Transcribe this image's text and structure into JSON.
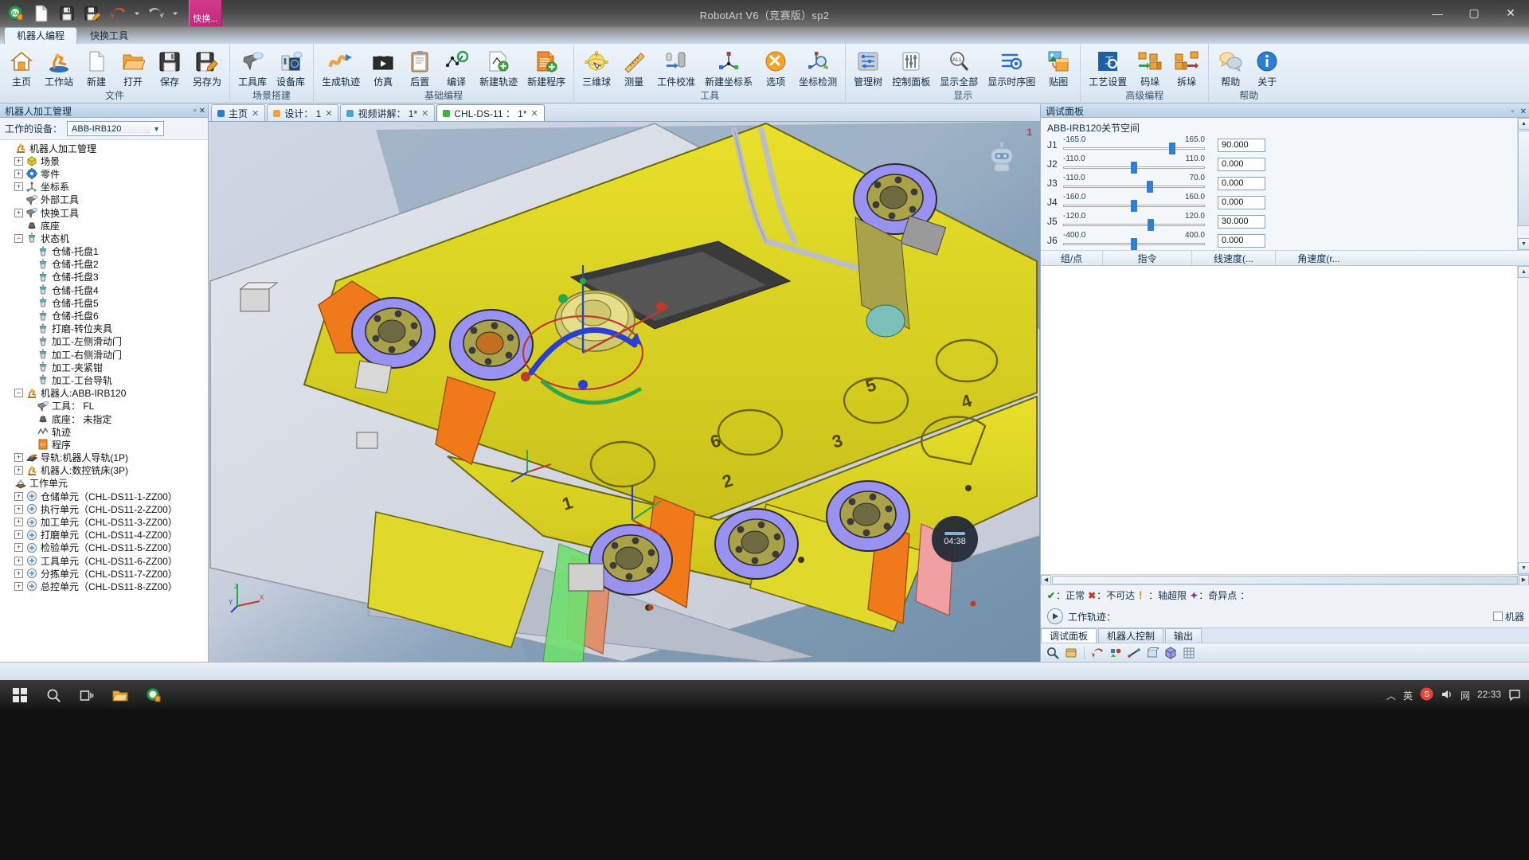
{
  "window": {
    "title": "RobotArt V6（竞赛版）sp2",
    "minimize": "—",
    "maximize": "▢",
    "close": "✕"
  },
  "quick_access": {
    "items": [
      {
        "name": "app-logo-icon",
        "label": "RobotArt"
      },
      {
        "name": "new-file-icon",
        "label": "新建"
      },
      {
        "name": "save-icon",
        "label": "保存"
      },
      {
        "name": "save-as-icon",
        "label": "另存为"
      },
      {
        "name": "undo-icon",
        "label": "撤销"
      },
      {
        "name": "redo-icon",
        "label": "重做"
      }
    ],
    "pinned_tab": "快换..."
  },
  "ribbon": {
    "tabs": [
      {
        "label": "机器人编程",
        "active": true
      },
      {
        "label": "快换工具",
        "active": false
      }
    ],
    "groups": [
      {
        "title": "文件",
        "items": [
          {
            "label": "主页",
            "icon": "home-icon"
          },
          {
            "label": "工作站",
            "icon": "workstation-icon"
          },
          {
            "label": "新建",
            "icon": "new-document-icon"
          },
          {
            "label": "打开",
            "icon": "open-folder-icon"
          },
          {
            "label": "保存",
            "icon": "floppy-save-icon"
          },
          {
            "label": "另存为",
            "icon": "floppy-save-as-icon"
          }
        ]
      },
      {
        "title": "场景搭建",
        "items": [
          {
            "label": "工具库",
            "icon": "tool-library-icon"
          },
          {
            "label": "设备库",
            "icon": "device-library-icon"
          }
        ]
      },
      {
        "title": "基础编程",
        "items": [
          {
            "label": "生成轨迹",
            "icon": "generate-path-icon"
          },
          {
            "label": "仿真",
            "icon": "simulation-icon"
          },
          {
            "label": "后置",
            "icon": "postprocess-icon"
          },
          {
            "label": "编译",
            "icon": "compile-icon"
          },
          {
            "label": "新建轨迹",
            "icon": "new-path-icon"
          },
          {
            "label": "新建程序",
            "icon": "new-program-icon"
          }
        ]
      },
      {
        "title": "工具",
        "items": [
          {
            "label": "三维球",
            "icon": "triball-icon"
          },
          {
            "label": "测量",
            "icon": "measure-icon"
          },
          {
            "label": "工件校准",
            "icon": "workpiece-calibration-icon"
          },
          {
            "label": "新建坐标系",
            "icon": "new-coordinate-system-icon"
          },
          {
            "label": "选项",
            "icon": "options-icon"
          },
          {
            "label": "坐标检测",
            "icon": "coordinate-detect-icon"
          }
        ]
      },
      {
        "title": "显示",
        "items": [
          {
            "label": "管理树",
            "icon": "manage-tree-icon"
          },
          {
            "label": "控制面板",
            "icon": "control-panel-icon"
          },
          {
            "label": "显示全部",
            "icon": "show-all-icon"
          },
          {
            "label": "显示时序图",
            "icon": "show-timeline-icon"
          },
          {
            "label": "贴图",
            "icon": "texture-icon"
          }
        ]
      },
      {
        "title": "高级编程",
        "items": [
          {
            "label": "工艺设置",
            "icon": "process-settings-icon"
          },
          {
            "label": "码垛",
            "icon": "palletize-icon"
          },
          {
            "label": "拆垛",
            "icon": "depalletize-icon"
          }
        ]
      },
      {
        "title": "帮助",
        "items": [
          {
            "label": "帮助",
            "icon": "help-icon"
          },
          {
            "label": "关于",
            "icon": "about-icon"
          }
        ]
      }
    ]
  },
  "document_tabs": [
    {
      "label": "主页",
      "active": false,
      "closable": true
    },
    {
      "label": "设计： 1",
      "active": false,
      "closable": true
    },
    {
      "label": "视频讲解： 1*",
      "active": false,
      "closable": true
    },
    {
      "label": "CHL-DS-11 ： 1*",
      "active": true,
      "closable": true
    }
  ],
  "left_panel": {
    "title": "机器人加工管理",
    "device_label": "工作的设备：",
    "device_value": "ABB-IRB120",
    "tree": [
      {
        "label": "机器人加工管理",
        "indent": 0,
        "toggle": "none",
        "icon": "robot-icon"
      },
      {
        "label": "场景",
        "indent": 1,
        "toggle": "plus",
        "icon": "scene-icon"
      },
      {
        "label": "零件",
        "indent": 1,
        "toggle": "plus",
        "icon": "part-icon"
      },
      {
        "label": "坐标系",
        "indent": 1,
        "toggle": "plus",
        "icon": "coordinate-icon"
      },
      {
        "label": "外部工具",
        "indent": 1,
        "toggle": "none",
        "icon": "tool-icon"
      },
      {
        "label": "快换工具",
        "indent": 1,
        "toggle": "plus",
        "icon": "tool-icon"
      },
      {
        "label": "底座",
        "indent": 1,
        "toggle": "none",
        "icon": "base-icon"
      },
      {
        "label": "状态机",
        "indent": 1,
        "toggle": "minus",
        "icon": "statemachine-icon"
      },
      {
        "label": "仓储-托盘1",
        "indent": 2,
        "toggle": "none",
        "icon": "statemachine-icon"
      },
      {
        "label": "仓储-托盘2",
        "indent": 2,
        "toggle": "none",
        "icon": "statemachine-icon"
      },
      {
        "label": "仓储-托盘3",
        "indent": 2,
        "toggle": "none",
        "icon": "statemachine-icon"
      },
      {
        "label": "仓储-托盘4",
        "indent": 2,
        "toggle": "none",
        "icon": "statemachine-icon"
      },
      {
        "label": "仓储-托盘5",
        "indent": 2,
        "toggle": "none",
        "icon": "statemachine-icon"
      },
      {
        "label": "仓储-托盘6",
        "indent": 2,
        "toggle": "none",
        "icon": "statemachine-icon"
      },
      {
        "label": "打磨-转位夹具",
        "indent": 2,
        "toggle": "none",
        "icon": "statemachine-icon"
      },
      {
        "label": "加工-左侧滑动门",
        "indent": 2,
        "toggle": "none",
        "icon": "statemachine-icon"
      },
      {
        "label": "加工-右侧滑动门",
        "indent": 2,
        "toggle": "none",
        "icon": "statemachine-icon"
      },
      {
        "label": "加工-夹紧钳",
        "indent": 2,
        "toggle": "none",
        "icon": "statemachine-icon"
      },
      {
        "label": "加工-工台导轨",
        "indent": 2,
        "toggle": "none",
        "icon": "statemachine-icon"
      },
      {
        "label": "机器人:ABB-IRB120",
        "indent": 1,
        "toggle": "minus",
        "icon": "robot-icon"
      },
      {
        "label": "工具： FL",
        "indent": 2,
        "toggle": "none",
        "icon": "tool-icon"
      },
      {
        "label": "底座： 未指定",
        "indent": 2,
        "toggle": "none",
        "icon": "base-icon"
      },
      {
        "label": "轨迹",
        "indent": 2,
        "toggle": "none",
        "icon": "path-icon"
      },
      {
        "label": "程序",
        "indent": 2,
        "toggle": "none",
        "icon": "program-icon"
      },
      {
        "label": "导轨:机器人导轨(1P)",
        "indent": 1,
        "toggle": "plus",
        "icon": "rail-icon"
      },
      {
        "label": "机器人:数控铣床(3P)",
        "indent": 1,
        "toggle": "plus",
        "icon": "robot-icon"
      },
      {
        "label": "工作单元",
        "indent": 0,
        "toggle": "none",
        "icon": "workcell-icon"
      },
      {
        "label": "仓储单元（CHL-DS11-1-ZZ00）",
        "indent": 1,
        "toggle": "plus",
        "icon": "unit-icon"
      },
      {
        "label": "执行单元（CHL-DS11-2-ZZ00）",
        "indent": 1,
        "toggle": "plus",
        "icon": "unit-icon"
      },
      {
        "label": "加工单元（CHL-DS11-3-ZZ00）",
        "indent": 1,
        "toggle": "plus",
        "icon": "unit-icon"
      },
      {
        "label": "打磨单元（CHL-DS11-4-ZZ00）",
        "indent": 1,
        "toggle": "plus",
        "icon": "unit-icon"
      },
      {
        "label": "检验单元（CHL-DS11-5-ZZ00）",
        "indent": 1,
        "toggle": "plus",
        "icon": "unit-icon"
      },
      {
        "label": "工具单元（CHL-DS11-6-ZZ00）",
        "indent": 1,
        "toggle": "plus",
        "icon": "unit-icon"
      },
      {
        "label": "分拣单元（CHL-DS11-7-ZZ00）",
        "indent": 1,
        "toggle": "plus",
        "icon": "unit-icon"
      },
      {
        "label": "总控单元（CHL-DS11-8-ZZ00）",
        "indent": 1,
        "toggle": "plus",
        "icon": "unit-icon"
      }
    ]
  },
  "viewport": {
    "corner_number": "1",
    "timer": "04:38",
    "axis_labels": {
      "x": "X",
      "y": "Y",
      "z": "Z"
    },
    "scene_numbers": [
      "1",
      "2",
      "3",
      "4",
      "5",
      "6"
    ]
  },
  "right_panel": {
    "title": "调试面板",
    "joint_space_title": "ABB-IRB120关节空间",
    "joints": [
      {
        "name": "J1",
        "min": "-165.0",
        "max": "165.0",
        "value": "90.000",
        "pos_pct": 77
      },
      {
        "name": "J2",
        "min": "-110.0",
        "max": "110.0",
        "value": "0.000",
        "pos_pct": 50
      },
      {
        "name": "J3",
        "min": "-110.0",
        "max": "70.0",
        "value": "0.000",
        "pos_pct": 61
      },
      {
        "name": "J4",
        "min": "-160.0",
        "max": "160.0",
        "value": "0.000",
        "pos_pct": 50
      },
      {
        "name": "J5",
        "min": "-120.0",
        "max": "120.0",
        "value": "30.000",
        "pos_pct": 62
      },
      {
        "name": "J6",
        "min": "-400.0",
        "max": "400.0",
        "value": "0.000",
        "pos_pct": 50
      }
    ],
    "grid_headers": [
      "组/点",
      "指令",
      "线速度(...",
      "角速度(r..."
    ],
    "legend": [
      {
        "symbol": "✔",
        "text": "：正常",
        "color": "#1f8a3a"
      },
      {
        "symbol": "✖",
        "text": "：不可达",
        "color": "#c0392b"
      },
      {
        "symbol": "！",
        "text": "：轴超限",
        "color": "#d88b00"
      },
      {
        "symbol": "✦",
        "text": "：奇异点",
        "color": "#8a2bbf"
      }
    ],
    "legend_suffix": "：",
    "play_label": "工作轨迹：",
    "checkbox_label": "机器",
    "tabs": [
      {
        "label": "调试面板",
        "active": true
      },
      {
        "label": "机器人控制",
        "active": false
      },
      {
        "label": "输出",
        "active": false
      }
    ],
    "toolbar_icons": [
      "zoom-icon",
      "card-icon",
      "sep",
      "undo-small-icon",
      "shapes-icon",
      "line-icon",
      "box-icon",
      "cube-icon",
      "grid-icon"
    ],
    "panel_buttons": [
      "▫",
      "✕"
    ]
  },
  "taskbar": {
    "start_icon": "windows-start-icon",
    "items": [
      {
        "name": "search-icon",
        "label": "搜索"
      },
      {
        "name": "taskview-icon",
        "label": "任务视图"
      },
      {
        "name": "explorer-icon",
        "label": "文件资源管理器"
      },
      {
        "name": "robotart-icon",
        "label": "RobotArt"
      }
    ],
    "tray": {
      "chevron": "︿",
      "ime": "英",
      "sogou": "S",
      "volume": "🔊",
      "network": "网",
      "time": "22:33",
      "date": "",
      "notification": "▭"
    }
  }
}
